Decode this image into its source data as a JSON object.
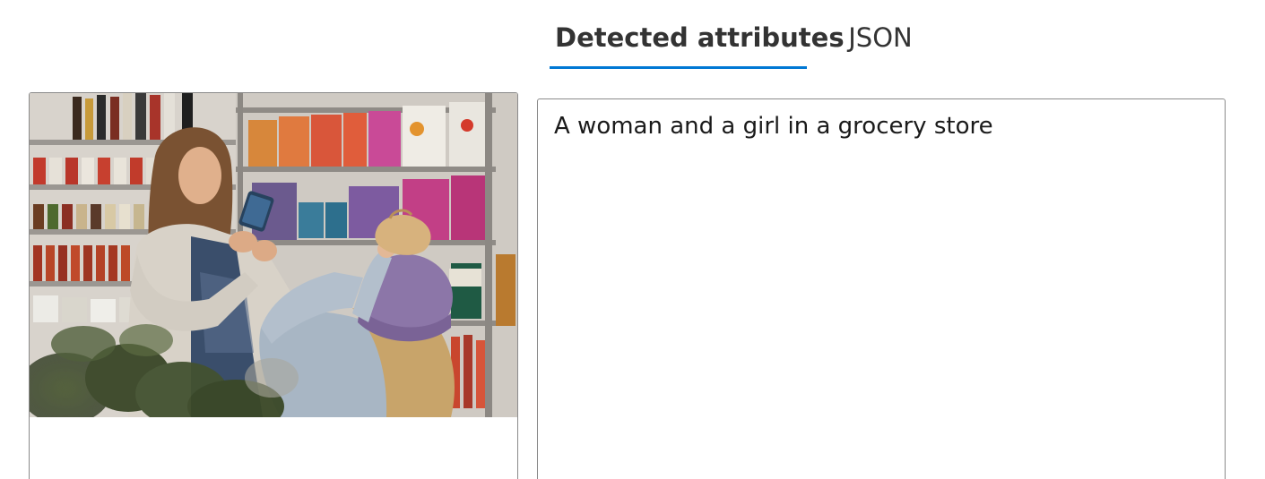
{
  "tabs": {
    "detected_label": "Detected attributes",
    "json_label": "JSON",
    "active": "detected"
  },
  "image": {
    "alt": "A woman and a girl in a grocery store"
  },
  "result": {
    "caption": "A woman and a girl in a grocery store"
  },
  "colors": {
    "accent": "#0078d4",
    "border": "#8a8a8a",
    "text": "#333333"
  }
}
